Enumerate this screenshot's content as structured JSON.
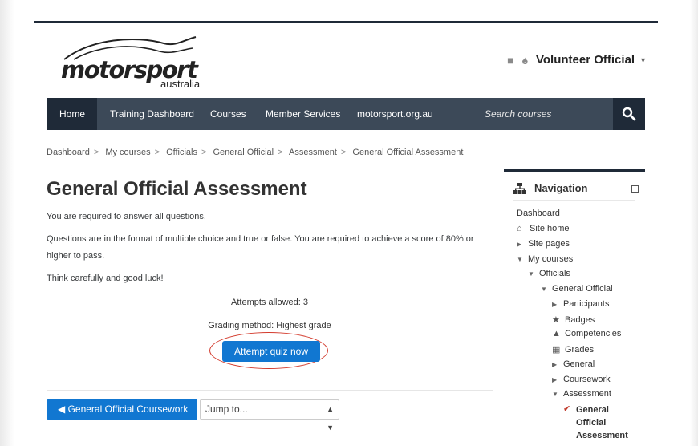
{
  "logo": {
    "word": "motorsport",
    "sub": "australia"
  },
  "user": {
    "name": "Volunteer Official"
  },
  "navbar": {
    "items": [
      "Home",
      "Training Dashboard",
      "Courses",
      "Member Services",
      "motorsport.org.au"
    ],
    "search_placeholder": "Search courses"
  },
  "breadcrumb": [
    "Dashboard",
    "My courses",
    "Officials",
    "General Official",
    "Assessment",
    "General Official Assessment"
  ],
  "page": {
    "title": "General Official Assessment",
    "paragraphs": [
      "You are required to answer all questions.",
      "Questions are in the format of multiple choice and true or false. You are required to achieve a score of 80% or higher to pass.",
      "Think carefully and good luck!"
    ],
    "attempts": "Attempts allowed: 3",
    "grading": "Grading method: Highest grade",
    "attempt_button": "Attempt quiz now"
  },
  "footer_nav": {
    "prev_label": "General Official Coursework",
    "jump_label": "Jump to..."
  },
  "navigation": {
    "title": "Navigation",
    "nodes": {
      "dashboard": "Dashboard",
      "site_home": "Site home",
      "site_pages": "Site pages",
      "my_courses": "My courses",
      "officials": "Officials",
      "general_official": "General Official",
      "participants": "Participants",
      "badges": "Badges",
      "competencies": "Competencies",
      "grades": "Grades",
      "general": "General",
      "coursework": "Coursework",
      "assessment": "Assessment",
      "current": "General Official Assessment"
    }
  },
  "colors": {
    "nav_bg": "#3c4958",
    "nav_dark": "#1f2a38",
    "primary": "#1177d1",
    "highlight": "#d33a2c"
  }
}
